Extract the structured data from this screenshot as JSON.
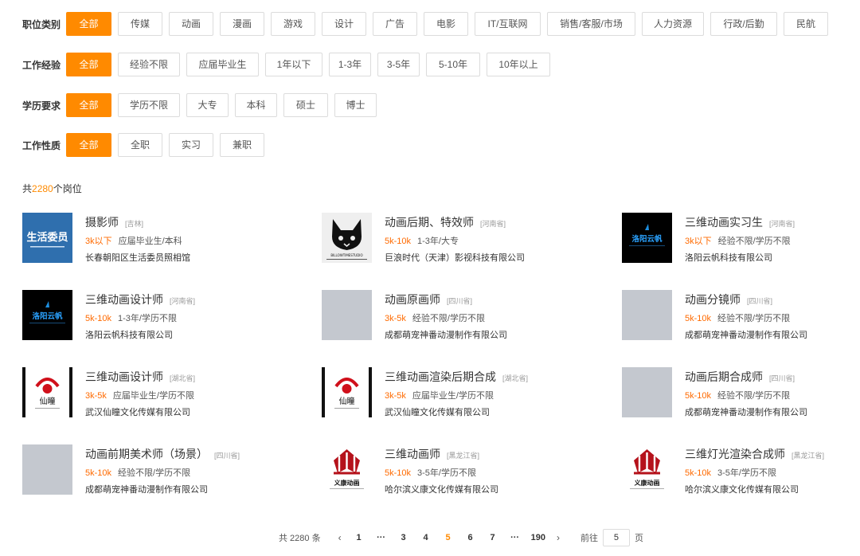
{
  "filters": {
    "category": {
      "label": "职位类别",
      "options": [
        "全部",
        "传媒",
        "动画",
        "漫画",
        "游戏",
        "设计",
        "广告",
        "电影",
        "IT/互联网",
        "销售/客服/市场",
        "人力资源",
        "行政/后勤",
        "民航"
      ]
    },
    "experience": {
      "label": "工作经验",
      "options": [
        "全部",
        "经验不限",
        "应届毕业生",
        "1年以下",
        "1-3年",
        "3-5年",
        "5-10年",
        "10年以上"
      ]
    },
    "education": {
      "label": "学历要求",
      "options": [
        "全部",
        "学历不限",
        "大专",
        "本科",
        "硕士",
        "博士"
      ]
    },
    "nature": {
      "label": "工作性质",
      "options": [
        "全部",
        "全职",
        "实习",
        "兼职"
      ]
    }
  },
  "results": {
    "prefix": "共",
    "count": "2280",
    "suffix": "个岗位"
  },
  "jobs": [
    {
      "title": "摄影师",
      "location": "[吉林]",
      "salary": "3k以下",
      "requirement": "应届毕业生/本科",
      "company": "长春朝阳区生活委员照相馆",
      "logo": "shenghuo-logo",
      "logo_text": "生活委员"
    },
    {
      "title": "动画后期、特效师",
      "location": "[河南省]",
      "salary": "5k-10k",
      "requirement": "1-3年/大专",
      "company": "巨浪时代（天津）影视科技有限公司",
      "logo": "cat-logo",
      "logo_text": "BILLOWTIMESTUDIO"
    },
    {
      "title": "三维动画实习生",
      "location": "[河南省]",
      "salary": "3k以下",
      "requirement": "经验不限/学历不限",
      "company": "洛阳云帆科技有限公司",
      "logo": "yunfan-logo",
      "logo_text": "洛阳云帆"
    },
    {
      "title": "三维动画设计师",
      "location": "[河南省]",
      "salary": "5k-10k",
      "requirement": "1-3年/学历不限",
      "company": "洛阳云帆科技有限公司",
      "logo": "yunfan-logo",
      "logo_text": "洛阳云帆"
    },
    {
      "title": "动画原画师",
      "location": "[四川省]",
      "salary": "3k-5k",
      "requirement": "经验不限/学历不限",
      "company": "成都萌宠神番动漫制作有限公司",
      "logo": "placeholder-logo"
    },
    {
      "title": "动画分镜师",
      "location": "[四川省]",
      "salary": "5k-10k",
      "requirement": "经验不限/学历不限",
      "company": "成都萌宠神番动漫制作有限公司",
      "logo": "placeholder-logo"
    },
    {
      "title": "三维动画设计师",
      "location": "[湖北省]",
      "salary": "3k-5k",
      "requirement": "应届毕业生/学历不限",
      "company": "武汉仙瞳文化传媒有限公司",
      "logo": "xiantong-logo",
      "logo_text": "仙瞳"
    },
    {
      "title": "三维动画渲染后期合成",
      "location": "[湖北省]",
      "salary": "3k-5k",
      "requirement": "应届毕业生/学历不限",
      "company": "武汉仙瞳文化传媒有限公司",
      "logo": "xiantong-logo",
      "logo_text": "仙瞳"
    },
    {
      "title": "动画后期合成师",
      "location": "[四川省]",
      "salary": "5k-10k",
      "requirement": "经验不限/学历不限",
      "company": "成都萌宠神番动漫制作有限公司",
      "logo": "placeholder-logo"
    },
    {
      "title": "动画前期美术师（场景）",
      "location": "[四川省]",
      "salary": "5k-10k",
      "requirement": "经验不限/学历不限",
      "company": "成都萌宠神番动漫制作有限公司",
      "logo": "placeholder-logo"
    },
    {
      "title": "三维动画师",
      "location": "[黑龙江省]",
      "salary": "5k-10k",
      "requirement": "3-5年/学历不限",
      "company": "哈尔滨义康文化传媒有限公司",
      "logo": "yikang-logo",
      "logo_text": "义康动画"
    },
    {
      "title": "三维灯光渲染合成师",
      "location": "[黑龙江省]",
      "salary": "5k-10k",
      "requirement": "3-5年/学历不限",
      "company": "哈尔滨义康文化传媒有限公司",
      "logo": "yikang-logo",
      "logo_text": "义康动画"
    }
  ],
  "pagination": {
    "total": "共 2280 条",
    "prev": "‹",
    "pages": [
      "1",
      "···",
      "3",
      "4",
      "5",
      "6",
      "7",
      "···",
      "190"
    ],
    "current": "5",
    "next": "›",
    "goto_label": "前往",
    "goto_value": "5",
    "unit": "页"
  },
  "colors": {
    "accent": "#ff8a00",
    "salary": "#ff6a00",
    "placeholder": "#c4c8cf"
  }
}
